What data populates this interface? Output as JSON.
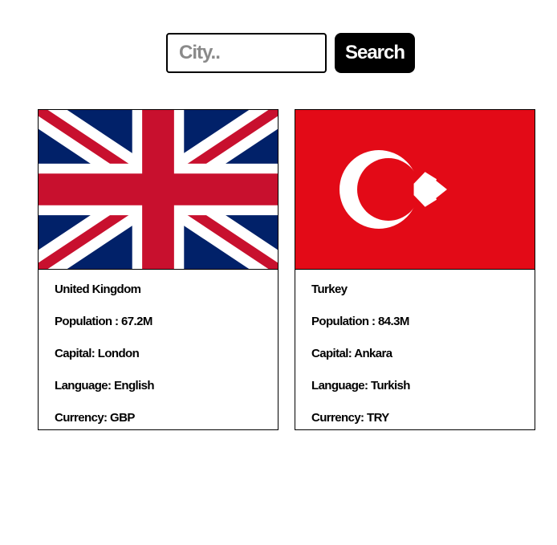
{
  "search": {
    "placeholder": "City..",
    "button_label": "Search"
  },
  "countries": [
    {
      "name": "United Kingdom",
      "population": "Population : 67.2M",
      "capital": "Capital: London",
      "language": "Language: English",
      "currency": "Currency: GBP",
      "flag_icon": "uk-flag-icon",
      "colors": {
        "blue": "#012169",
        "red": "#C8102E",
        "white": "#FFFFFF"
      }
    },
    {
      "name": "Turkey",
      "population": "Population : 84.3M",
      "capital": "Capital: Ankara",
      "language": "Language: Turkish",
      "currency": "Currency: TRY",
      "flag_icon": "turkey-flag-icon",
      "colors": {
        "red": "#E30A17",
        "white": "#FFFFFF"
      }
    }
  ]
}
